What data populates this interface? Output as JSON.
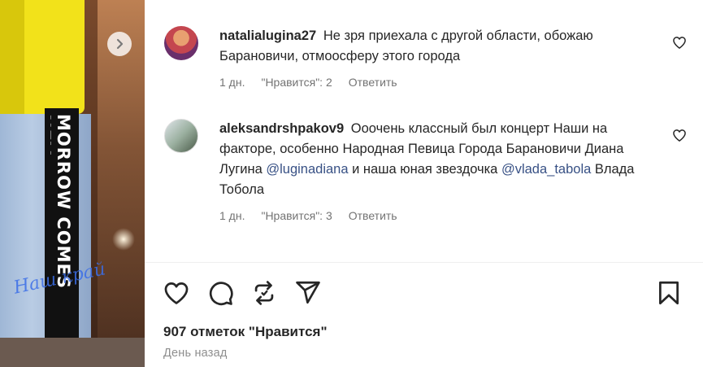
{
  "post": {
    "comments": [
      {
        "username": "natalialugina27",
        "text_parts": [
          "Не зря приехала с другой области, обожаю Барановичи, отмоосферу этого города"
        ],
        "age": "1 дн.",
        "likes_label": "\"Нравится\": 2",
        "reply_label": "Ответить"
      },
      {
        "username": "aleksandrshpakov9",
        "text_parts": [
          "Ооочень классный был концерт Наши на факторе, особенно Народная Певица Города Барановичи Диана Лугина ",
          " и наша юная звездочка ",
          " Влада Тобола"
        ],
        "mentions": [
          "@luginadiana",
          "@vlada_tabola"
        ],
        "age": "1 дн.",
        "likes_label": "\"Нравится\": 3",
        "reply_label": "Ответить"
      }
    ],
    "likes_count": "907 отметок \"Нравится\"",
    "timestamp": "День назад",
    "photo_text": "MORROW COMES NEV",
    "photo_watermark": "Наш край"
  },
  "icons": {
    "like": "heart-icon",
    "comment": "comment-icon",
    "repost": "repost-icon",
    "share": "send-icon",
    "save": "bookmark-icon",
    "next": "chevron-right-icon"
  }
}
